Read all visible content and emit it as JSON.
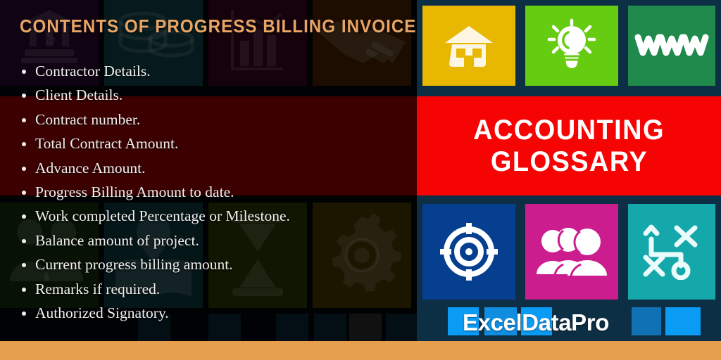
{
  "slide": {
    "title": "CONTENTS OF PROGRESS BILLING INVOICE",
    "title_color": "#e8a565",
    "bullets": [
      "Contractor Details.",
      "Client Details.",
      "Contract number.",
      "Total Contract Amount.",
      "Advance Amount.",
      "Progress Billing Amount to date.",
      "Work completed Percentage or Milestone.",
      "Balance amount of project.",
      "Current progress billing amount.",
      "Remarks if required.",
      "Authorized Signatory."
    ]
  },
  "banner": {
    "line1": "ACCOUNTING",
    "line2": "GLOSSARY",
    "background_color": "#f60404",
    "text_color": "#ffffff"
  },
  "brand": {
    "name": "ExcelDataPro",
    "accent_color": "#0a9bf5",
    "text_color": "#ffffff"
  },
  "bottom_strip": {
    "color": "#e69e4f"
  },
  "right_tiles": [
    {
      "icon": "house-icon",
      "color": "#e8b800",
      "icon_color": "#fdf6e3",
      "label": "Home"
    },
    {
      "icon": "lightbulb-icon",
      "color": "#66cc11",
      "icon_color": "#ffffff",
      "label": "Idea"
    },
    {
      "icon": "www-icon",
      "color": "#1f8a4c",
      "icon_color": "#ffffff",
      "label": "www"
    },
    {
      "icon": "target-icon",
      "color": "#063f8f",
      "icon_color": "#ffffff",
      "label": "Target"
    },
    {
      "icon": "people-icon",
      "color": "#cc1d8f",
      "icon_color": "#ffffff",
      "label": "Team"
    },
    {
      "icon": "strategy-icon",
      "color": "#14a8ab",
      "icon_color": "#e9fbfb",
      "label": "Strategy"
    }
  ],
  "left_background_tiles": [
    {
      "icon": "bank-icon",
      "color": "#2b0a36"
    },
    {
      "icon": "coins-icon",
      "color": "#10454d"
    },
    {
      "icon": "bar-chart-icon",
      "color": "#3a0722"
    },
    {
      "icon": "handshake-icon",
      "color": "#4a2400"
    },
    {
      "icon": "people-icon",
      "color": "#14300f"
    },
    {
      "icon": "book-icon",
      "color": "#0e3b42"
    },
    {
      "icon": "hourglass-icon",
      "color": "#2c3c05"
    },
    {
      "icon": "gear-icon",
      "color": "#4a3a00"
    }
  ],
  "left_overlay": {
    "red_band_color": "#3d0000",
    "dim_color": "rgba(0,0,0,0.62)"
  }
}
